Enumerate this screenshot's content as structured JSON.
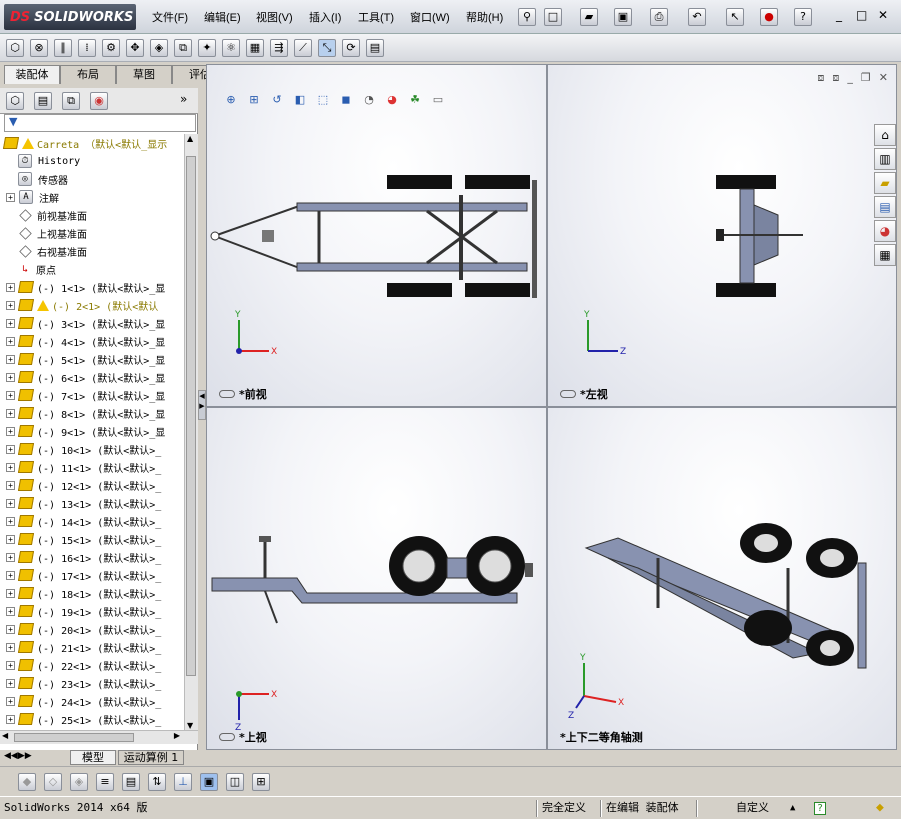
{
  "app": {
    "logo_text": "SOLIDWORKS",
    "logo_prefix": "DS"
  },
  "menu": {
    "items": [
      {
        "label": "文件(F)"
      },
      {
        "label": "编辑(E)"
      },
      {
        "label": "视图(V)"
      },
      {
        "label": "插入(I)"
      },
      {
        "label": "工具(T)"
      },
      {
        "label": "窗口(W)"
      },
      {
        "label": "帮助(H)"
      }
    ]
  },
  "command_tabs": [
    "装配体",
    "布局",
    "草图",
    "评估"
  ],
  "feature_manager": {
    "root": "Carreta （默认<默认_显示",
    "items": [
      {
        "label": "History",
        "icon": "history-icon"
      },
      {
        "label": "传感器",
        "icon": "sensor-icon"
      },
      {
        "label": "注解",
        "icon": "annotation-icon"
      },
      {
        "label": "前视基准面",
        "icon": "plane-icon"
      },
      {
        "label": "上视基准面",
        "icon": "plane-icon"
      },
      {
        "label": "右视基准面",
        "icon": "plane-icon"
      },
      {
        "label": "原点",
        "icon": "origin-icon"
      }
    ],
    "components": [
      {
        "label": "(-) 1<1> (默认<默认>_显",
        "warn": false
      },
      {
        "label": "(-) 2<1> (默认<默认",
        "warn": true
      },
      {
        "label": "(-) 3<1> (默认<默认>_显",
        "warn": false
      },
      {
        "label": "(-) 4<1> (默认<默认>_显",
        "warn": false
      },
      {
        "label": "(-) 5<1> (默认<默认>_显",
        "warn": false
      },
      {
        "label": "(-) 6<1> (默认<默认>_显",
        "warn": false
      },
      {
        "label": "(-) 7<1> (默认<默认>_显",
        "warn": false
      },
      {
        "label": "(-) 8<1> (默认<默认>_显",
        "warn": false
      },
      {
        "label": "(-) 9<1> (默认<默认>_显",
        "warn": false
      },
      {
        "label": "(-) 10<1> (默认<默认>_",
        "warn": false
      },
      {
        "label": "(-) 11<1> (默认<默认>_",
        "warn": false
      },
      {
        "label": "(-) 12<1> (默认<默认>_",
        "warn": false
      },
      {
        "label": "(-) 13<1> (默认<默认>_",
        "warn": false
      },
      {
        "label": "(-) 14<1> (默认<默认>_",
        "warn": false
      },
      {
        "label": "(-) 15<1> (默认<默认>_",
        "warn": false
      },
      {
        "label": "(-) 16<1> (默认<默认>_",
        "warn": false
      },
      {
        "label": "(-) 17<1> (默认<默认>_",
        "warn": false
      },
      {
        "label": "(-) 18<1> (默认<默认>_",
        "warn": false
      },
      {
        "label": "(-) 19<1> (默认<默认>_",
        "warn": false
      },
      {
        "label": "(-) 20<1> (默认<默认>_",
        "warn": false
      },
      {
        "label": "(-) 21<1> (默认<默认>_",
        "warn": false
      },
      {
        "label": "(-) 22<1> (默认<默认>_",
        "warn": false
      },
      {
        "label": "(-) 23<1> (默认<默认>_",
        "warn": false
      },
      {
        "label": "(-) 24<1> (默认<默认>_",
        "warn": false
      },
      {
        "label": "(-) 25<1> (默认<默认>_",
        "warn": false
      }
    ]
  },
  "model_tabs": [
    "模型",
    "运动算例 1"
  ],
  "viewports": {
    "front": "*前视",
    "left": "*左视",
    "top": "*上视",
    "iso": "*上下二等角轴测"
  },
  "axes": {
    "x": "X",
    "y": "Y",
    "z": "Z"
  },
  "status": {
    "version": "SolidWorks 2014 x64 版",
    "state": "完全定义",
    "mode": "在编辑 装配体",
    "units": "自定义",
    "help": "?"
  }
}
